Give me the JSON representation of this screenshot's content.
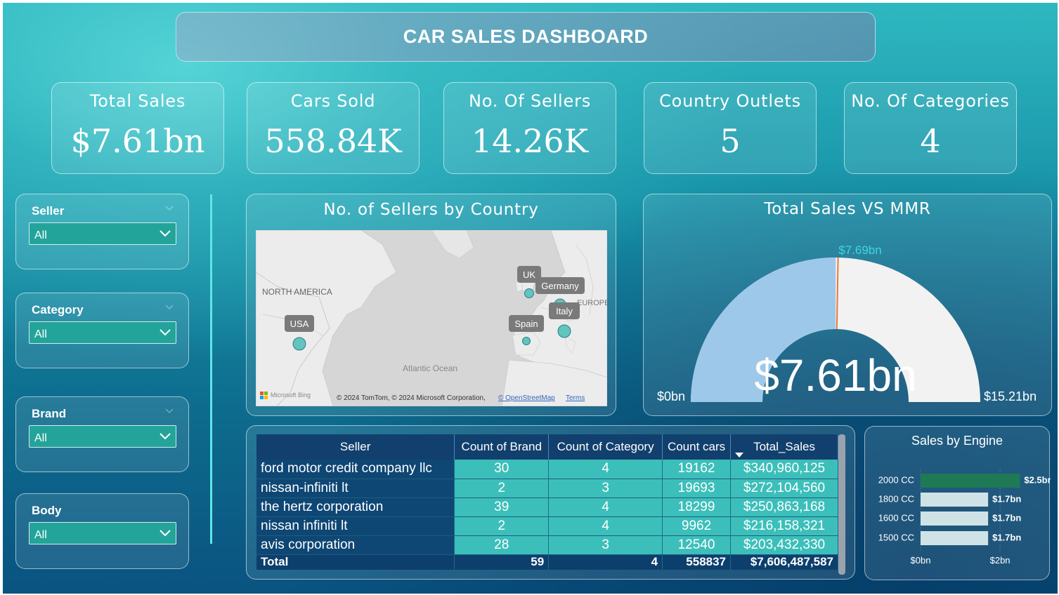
{
  "title": "CAR SALES DASHBOARD",
  "kpis": [
    {
      "label": "Total Sales",
      "value": "$7.61bn"
    },
    {
      "label": "Cars Sold",
      "value": "558.84K"
    },
    {
      "label": "No. Of Sellers",
      "value": "14.26K"
    },
    {
      "label": "Country Outlets",
      "value": "5"
    },
    {
      "label": "No. Of Categories",
      "value": "4"
    }
  ],
  "slicers": [
    {
      "label": "Seller",
      "value": "All"
    },
    {
      "label": "Category",
      "value": "All"
    },
    {
      "label": "Brand",
      "value": "All"
    },
    {
      "label": "Body",
      "value": "All"
    }
  ],
  "map": {
    "title": "No. of Sellers by Country",
    "region_labels": [
      "NORTH AMERICA",
      "Atlantic Ocean",
      "EUROPE"
    ],
    "pins": [
      {
        "label": "USA"
      },
      {
        "label": "UK"
      },
      {
        "label": "Germany"
      },
      {
        "label": "Italy"
      },
      {
        "label": "Spain"
      }
    ],
    "attribution": "© 2024 TomTom, © 2024 Microsoft Corporation,",
    "osm_link": "© OpenStreetMap",
    "terms_link": "Terms",
    "bing_label": "Microsoft Bing"
  },
  "gauge": {
    "title": "Total Sales VS MMR",
    "value_label": "$7.61bn",
    "target_label": "$7.69bn",
    "min_label": "$0bn",
    "max_label": "$15.21bn",
    "value": 7.61,
    "target": 7.69,
    "min": 0,
    "max": 15.21,
    "fill_color": "#9ec8ea",
    "track_color": "#f2f2f2",
    "target_color": "#e8793a"
  },
  "table": {
    "headers": [
      "Seller",
      "Count of Brand",
      "Count of Category",
      "Count cars",
      "Total_Sales"
    ],
    "rows": [
      [
        "ford motor credit company llc",
        "30",
        "4",
        "19162",
        "$340,960,125"
      ],
      [
        "nissan-infiniti lt",
        "2",
        "3",
        "19693",
        "$272,104,560"
      ],
      [
        "the hertz corporation",
        "39",
        "4",
        "18299",
        "$250,863,168"
      ],
      [
        "nissan infiniti lt",
        "2",
        "4",
        "9962",
        "$216,158,321"
      ],
      [
        "avis corporation",
        "28",
        "3",
        "12540",
        "$203,432,330"
      ]
    ],
    "total": [
      "Total",
      "59",
      "4",
      "558837",
      "$7,606,487,587"
    ]
  },
  "chart_data": {
    "type": "bar",
    "title": "Sales by Engine",
    "categories": [
      "2000 CC",
      "1800 CC",
      "1600 CC",
      "1500 CC"
    ],
    "values": [
      2.5,
      1.7,
      1.7,
      1.7
    ],
    "data_labels": [
      "$2.5bn",
      "$1.7bn",
      "$1.7bn",
      "$1.7bn"
    ],
    "x_ticks": [
      "$0bn",
      "$2bn"
    ],
    "xlim": [
      0,
      2.6
    ],
    "orientation": "horizontal",
    "highlight_color": "#1e7a55",
    "bar_color": "#cfe3e6"
  }
}
